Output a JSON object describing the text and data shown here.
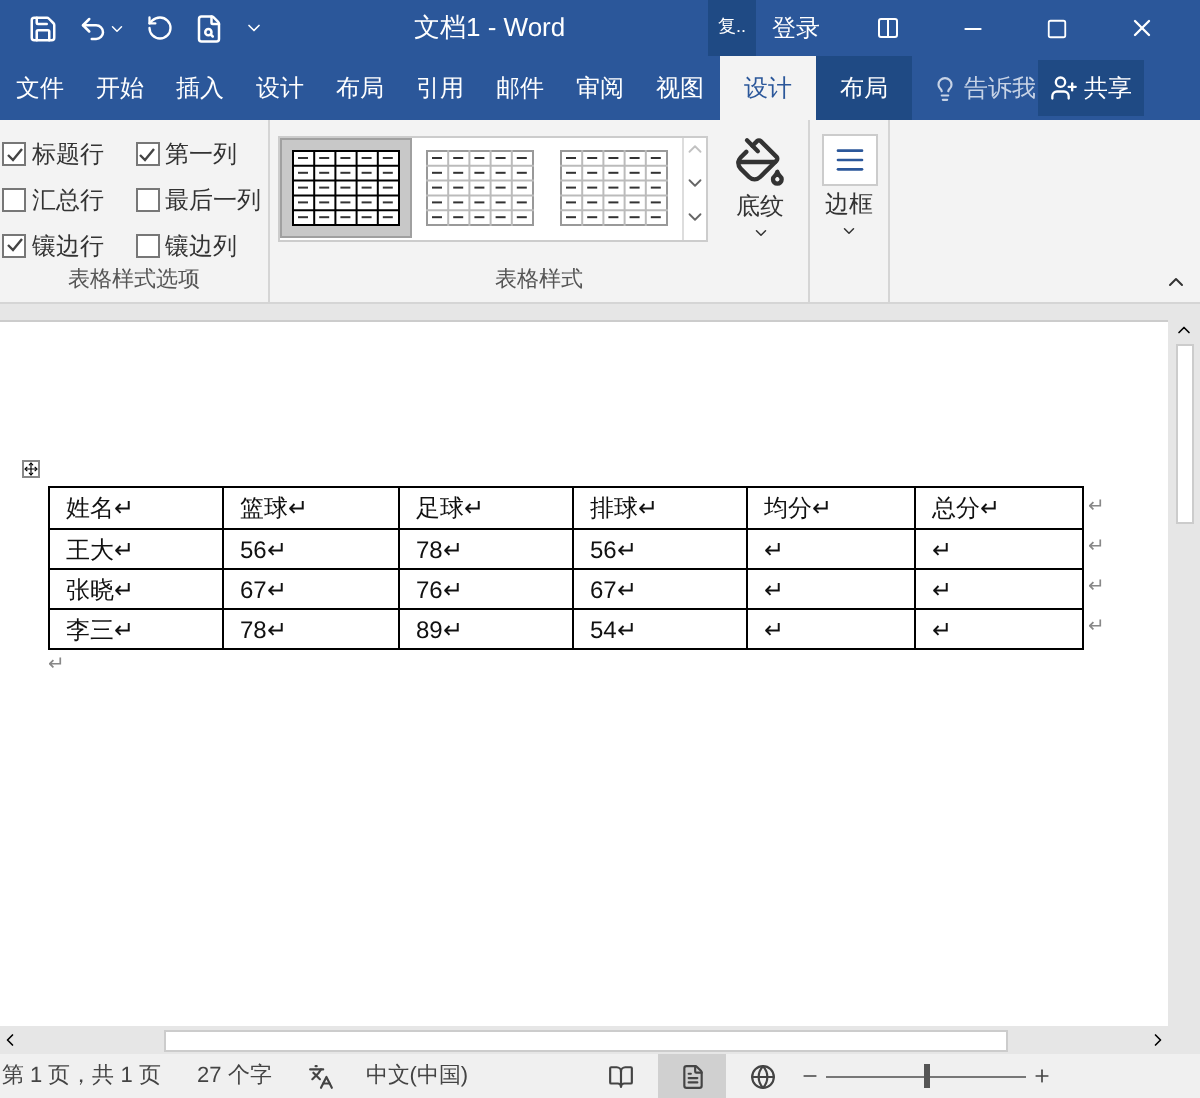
{
  "title_bar": {
    "title": "文档1  -  Word",
    "account_hint": "复..",
    "sign_in": "登录"
  },
  "tabs": [
    {
      "label": "文件",
      "selected": false,
      "kind": "normal"
    },
    {
      "label": "开始",
      "selected": false,
      "kind": "normal"
    },
    {
      "label": "插入",
      "selected": false,
      "kind": "normal"
    },
    {
      "label": "设计",
      "selected": false,
      "kind": "normal"
    },
    {
      "label": "布局",
      "selected": false,
      "kind": "normal"
    },
    {
      "label": "引用",
      "selected": false,
      "kind": "normal"
    },
    {
      "label": "邮件",
      "selected": false,
      "kind": "normal"
    },
    {
      "label": "审阅",
      "selected": false,
      "kind": "normal"
    },
    {
      "label": "视图",
      "selected": false,
      "kind": "normal"
    },
    {
      "label": "设计",
      "selected": true,
      "kind": "context"
    },
    {
      "label": "布局",
      "selected": false,
      "kind": "context"
    }
  ],
  "tell_me": "告诉我",
  "share": "共享",
  "style_options": {
    "label": "表格样式选项",
    "options": [
      {
        "label": "标题行",
        "checked": true
      },
      {
        "label": "第一列",
        "checked": true
      },
      {
        "label": "汇总行",
        "checked": false
      },
      {
        "label": "最后一列",
        "checked": false
      },
      {
        "label": "镶边行",
        "checked": true
      },
      {
        "label": "镶边列",
        "checked": false
      }
    ]
  },
  "table_styles": {
    "label": "表格样式",
    "styles": [
      {
        "selected": true
      },
      {
        "selected": false
      },
      {
        "selected": false
      }
    ],
    "shading": "底纹"
  },
  "borders": "边框",
  "document_table": {
    "rows": [
      [
        "姓名↵",
        "篮球↵",
        "足球↵",
        "排球↵",
        "均分↵",
        "总分↵"
      ],
      [
        "王大↵",
        "56↵",
        "78↵",
        "56↵",
        "↵",
        "↵"
      ],
      [
        "张晓↵",
        "67↵",
        "76↵",
        "67↵",
        "↵",
        "↵"
      ],
      [
        "李三↵",
        "78↵",
        "89↵",
        "54↵",
        "↵",
        "↵"
      ]
    ],
    "row_end_mark": "↵",
    "paragraph_mark": "↵"
  },
  "status_bar": {
    "page": "第 1 页，共 1 页",
    "words": "27 个字",
    "language": "中文(中国)",
    "zoom": {
      "level": 0.5
    }
  }
}
